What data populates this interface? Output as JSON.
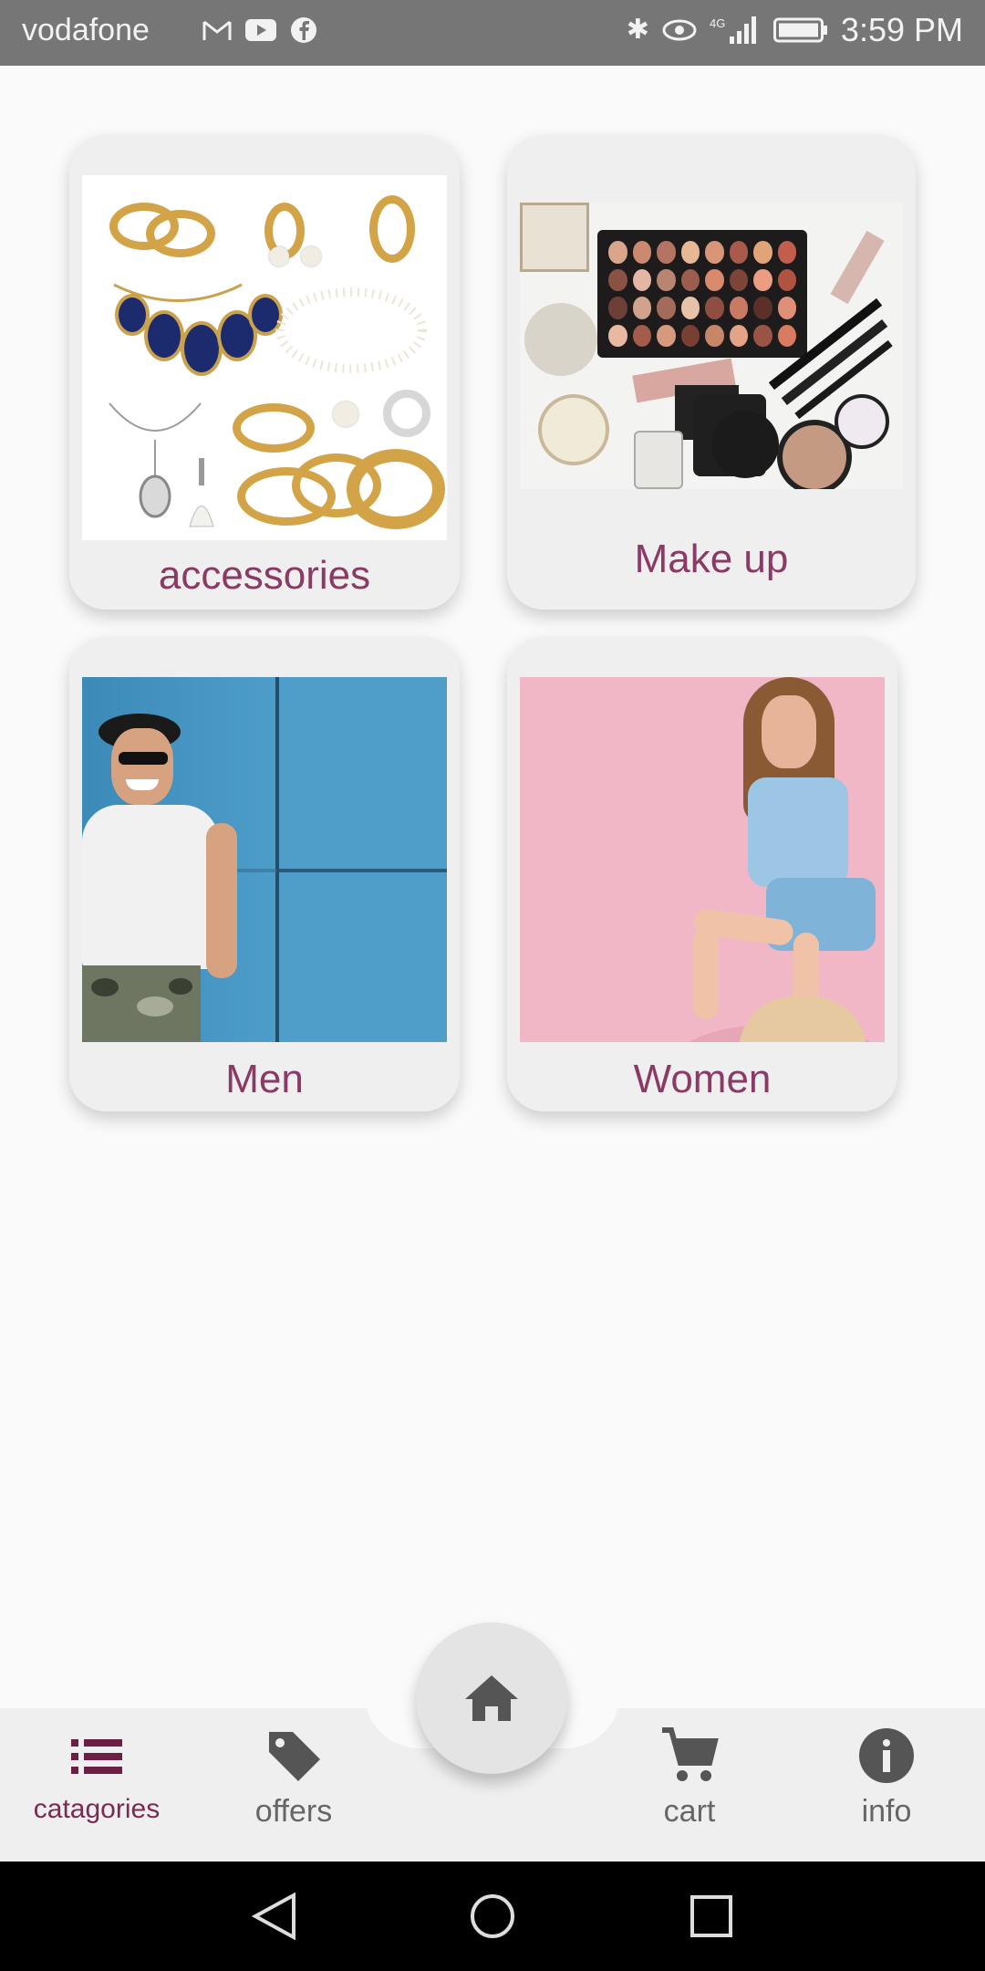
{
  "status_bar": {
    "carrier": "vodafone",
    "time": "3:59 PM",
    "network": "4G"
  },
  "categories": [
    {
      "label": "accessories",
      "image": "jewelry-photo"
    },
    {
      "label": "Make up",
      "image": "makeup-photo"
    },
    {
      "label": "Men",
      "image": "man-photo"
    },
    {
      "label": "Women",
      "image": "woman-photo"
    }
  ],
  "bottom_nav": {
    "items": [
      {
        "label": "catagories",
        "icon": "list-icon",
        "active": true
      },
      {
        "label": "offers",
        "icon": "tag-icon",
        "active": false
      },
      {
        "label": "cart",
        "icon": "cart-icon",
        "active": false
      },
      {
        "label": "info",
        "icon": "info-icon",
        "active": false
      }
    ],
    "home_icon": "home-icon"
  },
  "colors": {
    "accent": "#8a3a64",
    "active_nav": "#7a2a53",
    "status_bar": "#767676",
    "card_bg": "#efefef"
  }
}
